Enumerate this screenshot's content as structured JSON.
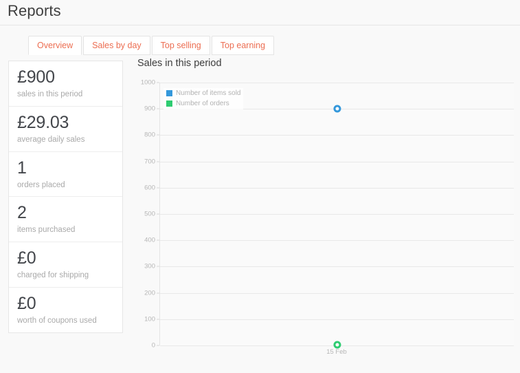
{
  "header": {
    "title": "Reports"
  },
  "tabs": [
    {
      "label": "Overview",
      "active": true
    },
    {
      "label": "Sales by day",
      "active": false
    },
    {
      "label": "Top selling",
      "active": false
    },
    {
      "label": "Top earning",
      "active": false
    }
  ],
  "stats": [
    {
      "value": "£900",
      "label": "sales in this period"
    },
    {
      "value": "£29.03",
      "label": "average daily sales"
    },
    {
      "value": "1",
      "label": "orders placed"
    },
    {
      "value": "2",
      "label": "items purchased"
    },
    {
      "value": "£0",
      "label": "charged for shipping"
    },
    {
      "value": "£0",
      "label": "worth of coupons used"
    }
  ],
  "colors": {
    "accent": "#ec6d51",
    "series_items_sold": "#3498db",
    "series_orders": "#2ecc71",
    "grid": "#e8e8e8",
    "plot_bg": "#fafafa",
    "page_bg": "#f9f9f9"
  },
  "chart_data": {
    "type": "scatter",
    "title": "Sales in this period",
    "xlabel": "",
    "ylabel": "",
    "x": [
      "15 Feb"
    ],
    "categories": [
      "15 Feb"
    ],
    "yticks": [
      0,
      100,
      200,
      300,
      400,
      500,
      600,
      700,
      800,
      900,
      1000
    ],
    "ylim": [
      0,
      1000
    ],
    "grid": true,
    "legend_position": "top-left",
    "series": [
      {
        "name": "Number of items sold",
        "color": "#3498db",
        "values": [
          900
        ]
      },
      {
        "name": "Number of orders",
        "color": "#2ecc71",
        "values": [
          2
        ]
      }
    ]
  }
}
